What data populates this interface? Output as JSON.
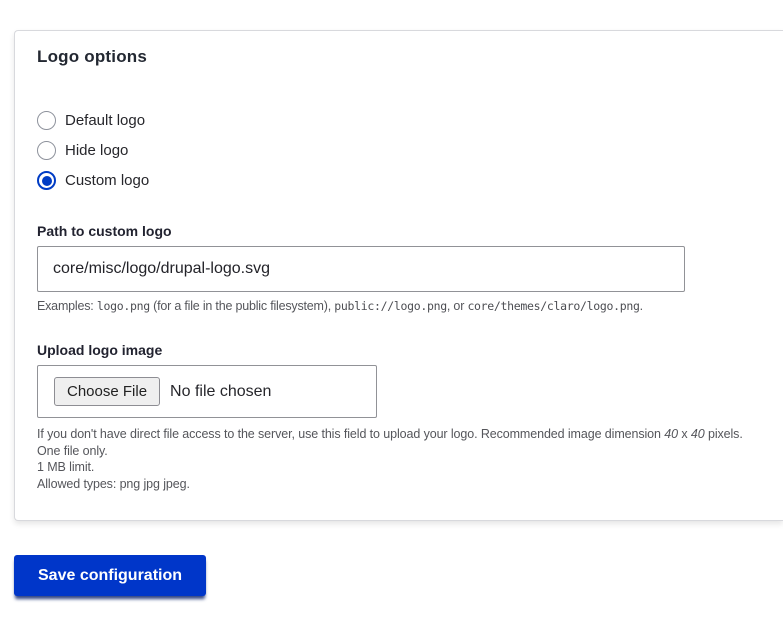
{
  "colors": {
    "accent": "#003cc5",
    "primary": "#0036c9"
  },
  "card": {
    "title": "Logo options",
    "radios": [
      {
        "label": "Default logo",
        "checked": false
      },
      {
        "label": "Hide logo",
        "checked": false
      },
      {
        "label": "Custom logo",
        "checked": true
      }
    ],
    "path_field": {
      "label": "Path to custom logo",
      "value": "core/misc/logo/drupal-logo.svg",
      "description": {
        "prefix": "Examples: ",
        "code1": "logo.png",
        "mid1": " (for a file in the public filesystem), ",
        "code2": "public://logo.png",
        "mid2": ", or ",
        "code3": "core/themes/claro/logo.png",
        "suffix": "."
      }
    },
    "upload_field": {
      "label": "Upload logo image",
      "choose_file_label": "Choose File",
      "file_status": "No file chosen",
      "description": {
        "line1_prefix": "If you don't have direct file access to the server, use this field to upload your logo. Recommended image dimension ",
        "dim1": "40",
        "dim_sep": " x ",
        "dim2": "40",
        "line1_suffix": " pixels.",
        "line2": "One file only.",
        "line3": "1 MB limit.",
        "line4": "Allowed types: png jpg jpeg."
      }
    }
  },
  "save_button": {
    "label": "Save configuration"
  }
}
